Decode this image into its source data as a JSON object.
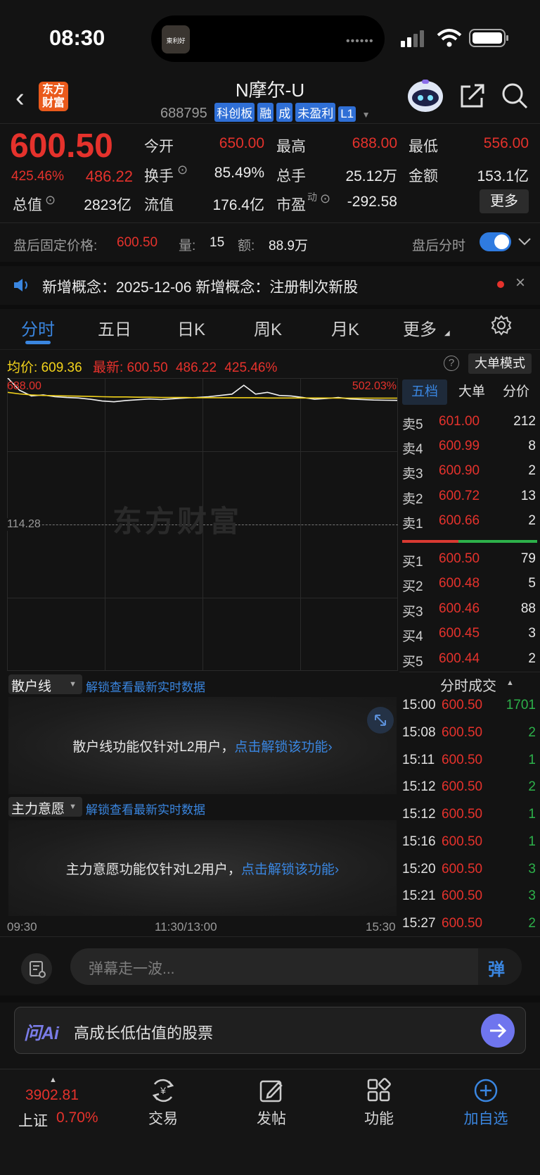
{
  "status_bar": {
    "time": "08:30",
    "island_text": "東利好"
  },
  "header": {
    "logo": "东方财富",
    "stock_name": "N摩尔-U",
    "stock_code": "688795",
    "tags": [
      "科创板",
      "融",
      "成",
      "未盈利",
      "L1"
    ]
  },
  "quote": {
    "price": "600.50",
    "change_pct": "425.46%",
    "change_amt": "486.22",
    "open_label": "今开",
    "open": "650.00",
    "high_label": "最高",
    "high": "688.00",
    "low_label": "最低",
    "low": "556.00",
    "turnover_label": "换手",
    "turnover": "85.49%",
    "volume_label": "总手",
    "volume": "25.12万",
    "amount_label": "金额",
    "amount": "153.1亿",
    "mktcap_label": "总值",
    "mktcap": "2823亿",
    "float_label": "流值",
    "float": "176.4亿",
    "pe_label": "市盈",
    "pe_sup": "动",
    "pe": "-292.58",
    "more_button": "更多"
  },
  "after_hours": {
    "price_label": "盘后固定价格:",
    "price": "600.50",
    "vol_label": "量:",
    "vol": "15",
    "amt_label": "额:",
    "amt": "88.9万",
    "toggle_label": "盘后分时",
    "toggle_on": true
  },
  "notice": {
    "text": "新增概念：2025-12-06 新增概念：注册制次新股"
  },
  "tabs": [
    "分时",
    "五日",
    "日K",
    "周K",
    "月K",
    "更多"
  ],
  "chart_info": {
    "avg_label": "均价:",
    "avg": "609.36",
    "last_label": "最新:",
    "last": "600.50",
    "last_chg": "486.22",
    "last_pct": "425.46%",
    "big_order_button": "大单模式"
  },
  "chart_data": {
    "type": "line",
    "y_top_label": "688.00",
    "y_mid_label": "114.28",
    "right_top_label": "502.03%",
    "x_labels": [
      "09:30",
      "11:30/13:00",
      "15:30"
    ],
    "series": [
      {
        "values": [
          688,
          640,
          618,
          622,
          615,
          612,
          610,
          605,
          598,
          595,
          600,
          603,
          606,
          604,
          607,
          610,
          612,
          615,
          620,
          625,
          660,
          625,
          632,
          620,
          618,
          612,
          605,
          608,
          612,
          606,
          604,
          602,
          601,
          600.5
        ]
      },
      {
        "values": [
          632,
          626,
          622,
          620,
          619,
          618,
          617,
          616,
          615,
          614,
          614,
          613,
          613,
          612,
          612,
          612,
          611,
          611,
          611,
          611,
          611,
          611,
          610,
          610,
          610,
          610,
          610,
          610,
          609.5,
          609.5,
          609.4,
          609.4,
          609.36,
          609.36
        ]
      }
    ],
    "colors": {
      "price": "#f2f2f2",
      "avg": "#f2d21b"
    }
  },
  "book_tabs": [
    "五档",
    "大单",
    "分价"
  ],
  "asks": [
    {
      "label": "卖5",
      "price": "601.00",
      "vol": "212"
    },
    {
      "label": "卖4",
      "price": "600.99",
      "vol": "8"
    },
    {
      "label": "卖3",
      "price": "600.90",
      "vol": "2"
    },
    {
      "label": "卖2",
      "price": "600.72",
      "vol": "13"
    },
    {
      "label": "卖1",
      "price": "600.66",
      "vol": "2"
    }
  ],
  "bids": [
    {
      "label": "买1",
      "price": "600.50",
      "vol": "79"
    },
    {
      "label": "买2",
      "price": "600.48",
      "vol": "5"
    },
    {
      "label": "买3",
      "price": "600.46",
      "vol": "88"
    },
    {
      "label": "买4",
      "price": "600.45",
      "vol": "3"
    },
    {
      "label": "买5",
      "price": "600.44",
      "vol": "2"
    }
  ],
  "ticks_title": "分时成交",
  "ticks": [
    {
      "time": "15:00",
      "price": "600.50",
      "vol": "1701"
    },
    {
      "time": "15:08",
      "price": "600.50",
      "vol": "2"
    },
    {
      "time": "15:11",
      "price": "600.50",
      "vol": "1"
    },
    {
      "time": "15:12",
      "price": "600.50",
      "vol": "2"
    },
    {
      "time": "15:12",
      "price": "600.50",
      "vol": "1"
    },
    {
      "time": "15:16",
      "price": "600.50",
      "vol": "1"
    },
    {
      "time": "15:20",
      "price": "600.50",
      "vol": "3"
    },
    {
      "time": "15:21",
      "price": "600.50",
      "vol": "3"
    },
    {
      "time": "15:27",
      "price": "600.50",
      "vol": "2"
    }
  ],
  "panels": {
    "retail": {
      "select": "散户线",
      "unlock": "解锁查看最新实时数据",
      "msg": "散户线功能仅针对L2用户，",
      "link": "点击解锁该功能"
    },
    "main": {
      "select": "主力意愿",
      "unlock": "解锁查看最新实时数据",
      "msg": "主力意愿功能仅针对L2用户，",
      "link": "点击解锁该功能"
    }
  },
  "comment_bar": {
    "placeholder": "弹幕走一波...",
    "danmu": "弹"
  },
  "ai_bar": {
    "logo": "问Ai",
    "text": "高成长低估值的股票"
  },
  "bottom_nav": {
    "index_value": "3902.81",
    "index_name": "上证",
    "index_pct": "0.70%",
    "items": [
      "交易",
      "发帖",
      "功能",
      "加自选"
    ]
  },
  "watermark": "东方财富"
}
